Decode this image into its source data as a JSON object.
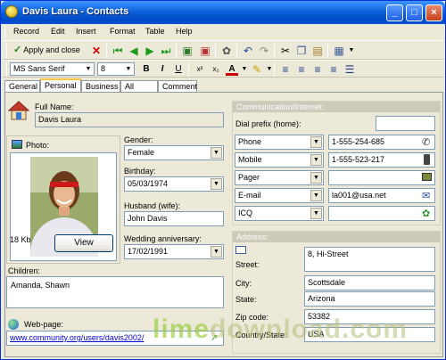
{
  "window": {
    "title": "Davis Laura - Contacts"
  },
  "menu": [
    "Record",
    "Edit",
    "Insert",
    "Format",
    "Table",
    "Help"
  ],
  "toolbar": {
    "apply_label": "Apply and close"
  },
  "format": {
    "font": "MS Sans Serif",
    "size": "8"
  },
  "tabs": [
    "General",
    "Personal",
    "Business",
    "All fields",
    "Comment"
  ],
  "personal": {
    "full_name_label": "Full Name:",
    "full_name": "Davis Laura",
    "photo_label": "Photo:",
    "photo_size": "18 Kb",
    "view_label": "View",
    "gender_label": "Gender:",
    "gender": "Female",
    "birthday_label": "Birthday:",
    "birthday": "05/03/1974",
    "husband_label": "Husband (wife):",
    "husband": "John Davis",
    "wedding_label": "Wedding anniversary:",
    "wedding": "17/02/1991",
    "children_label": "Children:",
    "children": "Amanda, Shawn",
    "webpage_label": "Web-page:",
    "webpage": "www.community.org/users/davis2002/"
  },
  "communication": {
    "title": "Communication/Internet:",
    "dial_label": "Dial prefix (home):",
    "dial_value": "",
    "rows": [
      {
        "type": "Phone",
        "value": "1-555-254-685"
      },
      {
        "type": "Mobile",
        "value": "1-555-523-217"
      },
      {
        "type": "Pager",
        "value": ""
      },
      {
        "type": "E-mail",
        "value": "la001@usa.net"
      },
      {
        "type": "ICQ",
        "value": ""
      }
    ]
  },
  "address": {
    "title": "Address:",
    "street_label": "Street:",
    "street": "8, Hi-Street",
    "city_label": "City:",
    "city": "Scottsdale",
    "state_label": "State:",
    "state": "Arizona",
    "zip_label": "Zip code:",
    "zip": "53382",
    "country_label": "Country/State:",
    "country": "USA"
  },
  "watermark": {
    "a": "lime",
    "b": "download",
    "c": ".com"
  },
  "colors": {
    "title_bar": "#0a5fd6",
    "accent_tab": "#ffc83c",
    "link": "#0000cc"
  }
}
